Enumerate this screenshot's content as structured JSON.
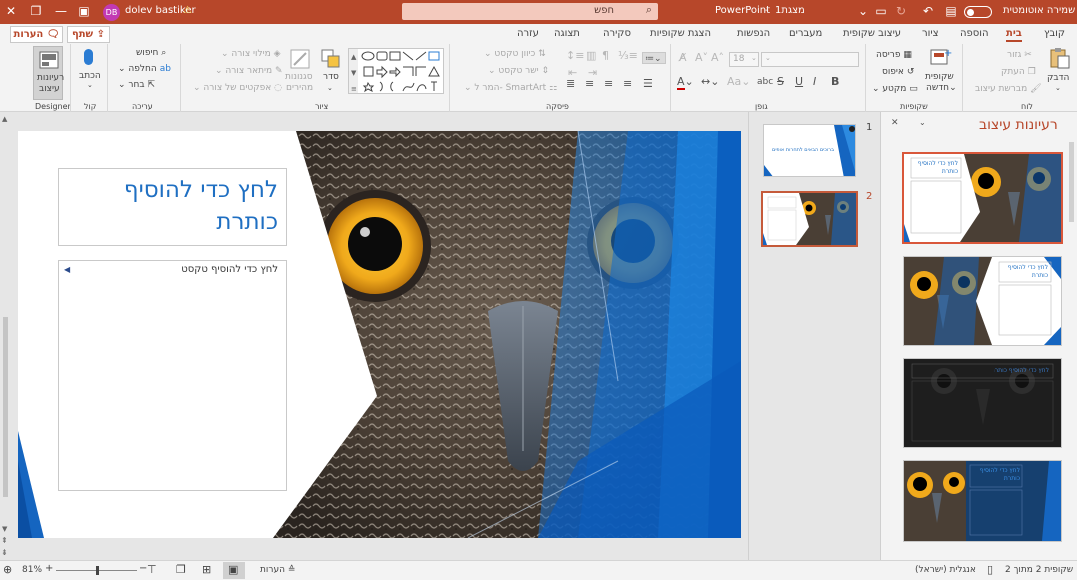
{
  "titlebar": {
    "autosave_label": "שמירה אוטומטית",
    "toggle_label": "כבוי",
    "filename": "מצגת1",
    "app": "PowerPoint",
    "search_placeholder": "חפש",
    "user_name": "dolev bastiker",
    "user_initials": "DB",
    "warning_icon": "warning-icon"
  },
  "tabs": [
    "קובץ",
    "בית",
    "הוספה",
    "ציור",
    "עיצוב שקופית",
    "מעברים",
    "הנפשות",
    "הצגת שקופיות",
    "סקירה",
    "תצוגה",
    "עזרה"
  ],
  "active_tab": "בית",
  "share_label": "שתף",
  "comments_label": "הערות",
  "ribbon": {
    "clipboard": {
      "label": "לוח",
      "paste": "הדבק",
      "cut": "גזור",
      "copy": "העתק",
      "format_painter": "מברשת עיצוב"
    },
    "slides": {
      "label": "שקופיות",
      "new_slide_1": "שקופית",
      "new_slide_2": "חדשה",
      "layout": "פריסה",
      "reset": "איפוס",
      "section": "מקטע"
    },
    "font": {
      "label": "גופן",
      "size": "18",
      "bold": "B",
      "italic": "I",
      "underline": "U",
      "strike": "S",
      "shadow": "abc",
      "grow": "A",
      "shrink": "A",
      "clear": "A"
    },
    "paragraph": {
      "label": "פיסקה",
      "text_direction": "כיוון טקסט",
      "align_text": "ישר טקסט",
      "smartart": "המר ל- SmartArt"
    },
    "drawing": {
      "label": "ציור",
      "arrange": "סדר",
      "quick_styles_1": "סגנונות",
      "quick_styles_2": "מהירים",
      "fill": "מילוי צורה",
      "outline": "מיתאר צורה",
      "effects": "אפקטים של צורה"
    },
    "editing": {
      "label": "עריכה",
      "find": "חיפוש",
      "replace": "החלפה",
      "select": "בחר"
    },
    "voice": {
      "label": "קול",
      "dictate": "הכתב"
    },
    "designer": {
      "label": "Designer",
      "ideas_1": "רעיונות",
      "ideas_2": "עיצוב"
    }
  },
  "slide": {
    "title_placeholder": "לחץ כדי להוסיף כותרת",
    "body_placeholder": "לחץ כדי להוסיף טקסט"
  },
  "thumbnails": [
    {
      "num": "1",
      "text": "ברוכים הבאים לתחרות אופים",
      "selected": false
    },
    {
      "num": "2",
      "text": "",
      "selected": true
    }
  ],
  "design_pane": {
    "title": "רעיונות עיצוב",
    "close_icon": "close-icon",
    "ideas": [
      {
        "title": "לחץ כדי להוסיף כותרת",
        "style": "light",
        "selected": true
      },
      {
        "title": "לחץ כדי להוסיף כותרת",
        "style": "blue-right",
        "selected": false
      },
      {
        "title": "לחץ כדי להוסיף כותרת",
        "style": "dark",
        "selected": false
      },
      {
        "title": "לחץ כדי להוסיף כותרת",
        "style": "navy",
        "selected": false
      }
    ]
  },
  "statusbar": {
    "slide_count": "שקופית 2 מתוך 2",
    "language": "אנגלית (ישראל)",
    "notes": "הערות",
    "zoom": "81%",
    "zoom_level": 0.5
  },
  "colors": {
    "accent": "#b7472a",
    "title_blue": "#1f6fc2",
    "slide_blue": "#1565c0"
  }
}
